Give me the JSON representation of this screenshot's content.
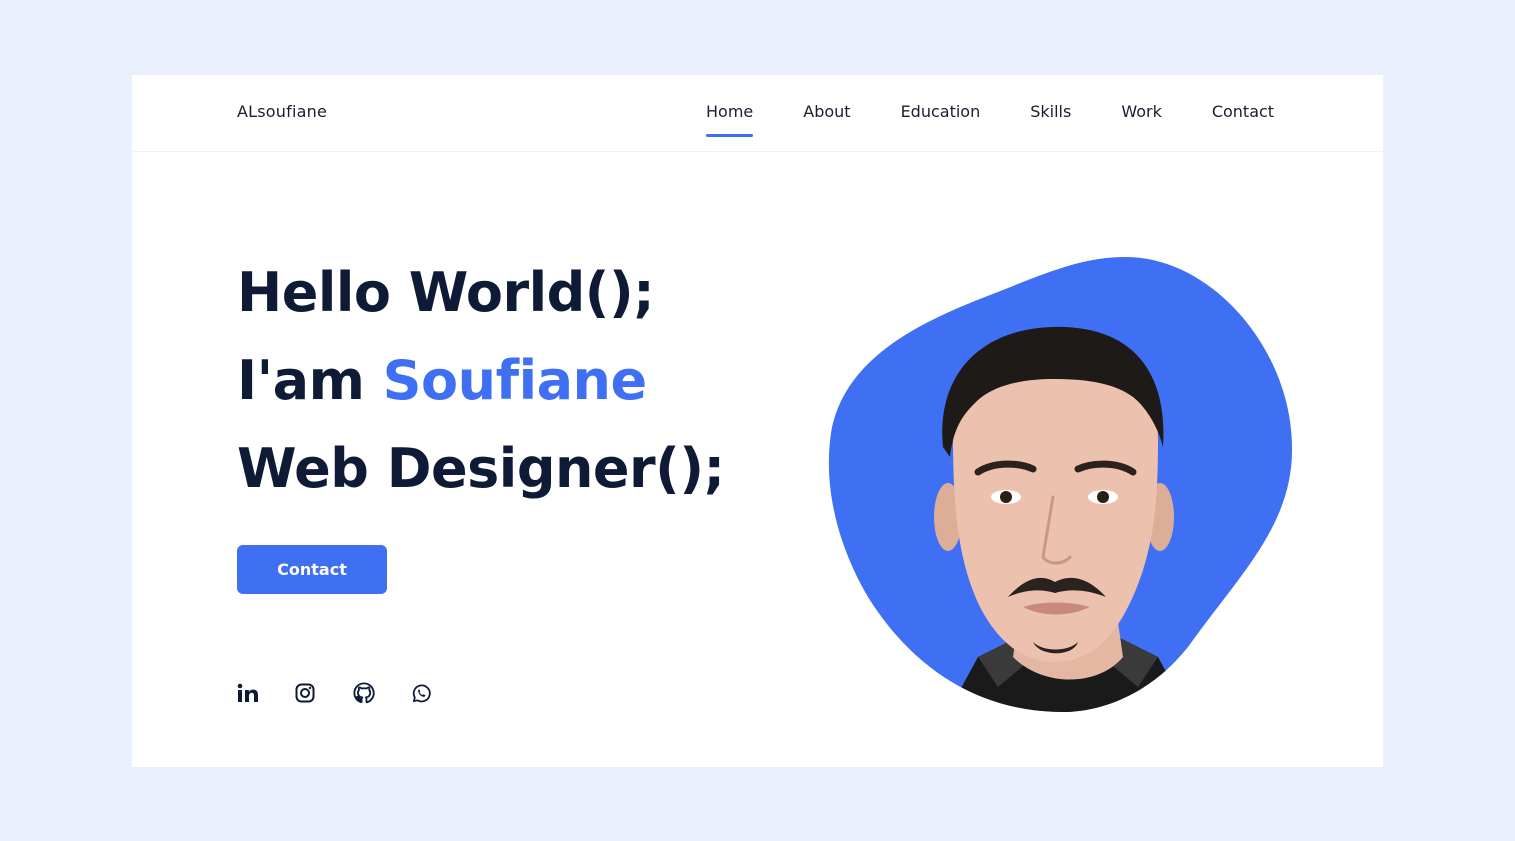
{
  "brand": {
    "name": "ALsoufiane",
    "accent_color": "#3f6ff2",
    "text_color": "#0f1a36",
    "background_color": "#e9effb"
  },
  "nav": {
    "items": [
      {
        "label": "Home",
        "active": true
      },
      {
        "label": "About",
        "active": false
      },
      {
        "label": "Education",
        "active": false
      },
      {
        "label": "Skills",
        "active": false
      },
      {
        "label": "Work",
        "active": false
      },
      {
        "label": "Contact",
        "active": false
      }
    ]
  },
  "hero": {
    "line1": "Hello World();",
    "line2_prefix": "I'am ",
    "line2_name": "Soufiane",
    "line3": "Web Designer();",
    "cta_label": "Contact"
  },
  "socials": [
    {
      "icon": "linkedin-icon"
    },
    {
      "icon": "instagram-icon"
    },
    {
      "icon": "github-icon"
    },
    {
      "icon": "whatsapp-icon"
    }
  ],
  "portrait": {
    "icon": "profile-photo"
  }
}
